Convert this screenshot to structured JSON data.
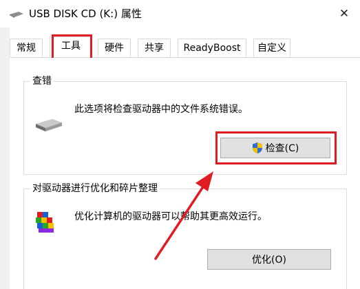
{
  "window": {
    "title": "USB DISK CD (K:) 属性",
    "close_symbol": "✕",
    "drive_icon": "usb-drive-icon"
  },
  "tabs": [
    {
      "label": "常规",
      "selected": false
    },
    {
      "label": "工具",
      "selected": true
    },
    {
      "label": "硬件",
      "selected": false
    },
    {
      "label": "共享",
      "selected": false
    },
    {
      "label": "ReadyBoost",
      "selected": false
    },
    {
      "label": "自定义",
      "selected": false
    }
  ],
  "error_check": {
    "title": "查错",
    "description": "此选项将检查驱动器中的文件系统错误。",
    "button_label": "检查(C)",
    "button_icon": "uac-shield-icon"
  },
  "optimize": {
    "title": "对驱动器进行优化和碎片整理",
    "description": "优化计算机的驱动器可以帮助其更高效运行。",
    "button_label": "优化(O)",
    "icon": "defrag-icon"
  },
  "annotations": {
    "highlight_color": "#e11b22"
  }
}
